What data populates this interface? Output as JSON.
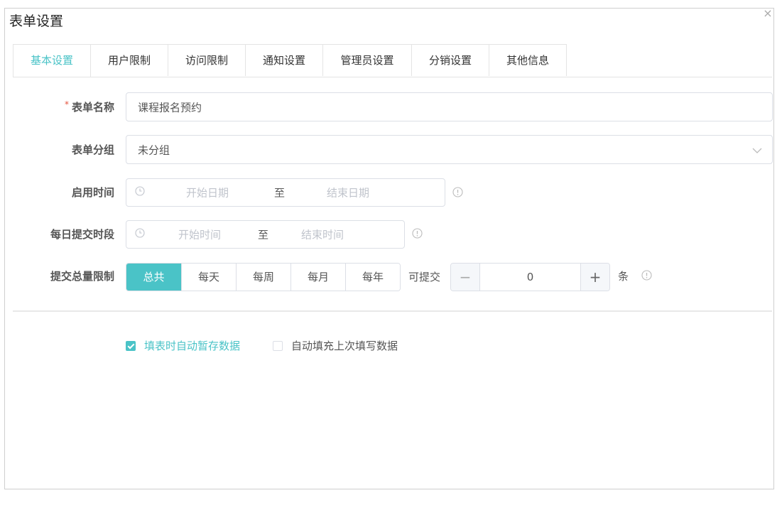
{
  "dialog": {
    "title": "表单设置",
    "close": "×"
  },
  "tabs": [
    {
      "label": "基本设置",
      "active": true
    },
    {
      "label": "用户限制"
    },
    {
      "label": "访问限制"
    },
    {
      "label": "通知设置"
    },
    {
      "label": "管理员设置"
    },
    {
      "label": "分销设置"
    },
    {
      "label": "其他信息"
    }
  ],
  "form": {
    "name": {
      "required_mark": "*",
      "label": "表单名称",
      "value": "课程报名预约"
    },
    "group": {
      "label": "表单分组",
      "value": "未分组"
    },
    "enable_time": {
      "label": "启用时间",
      "start_placeholder": "开始日期",
      "separator": "至",
      "end_placeholder": "结束日期"
    },
    "daily_period": {
      "label": "每日提交时段",
      "start_placeholder": "开始时间",
      "separator": "至",
      "end_placeholder": "结束时间"
    },
    "limit": {
      "label": "提交总量限制",
      "options": [
        "总共",
        "每天",
        "每周",
        "每月",
        "每年"
      ],
      "selected": "总共",
      "prefix": "可提交",
      "value": "0",
      "unit": "条"
    }
  },
  "checkboxes": [
    {
      "label": "填表时自动暂存数据",
      "checked": true
    },
    {
      "label": "自动填充上次填写数据",
      "checked": false
    }
  ],
  "colors": {
    "accent": "#4ac3c7",
    "required": "#e5533d",
    "placeholder": "#c0c4cc"
  },
  "icons": {
    "clock": "clock-icon",
    "info": "info-icon",
    "chevron": "chevron-down-icon"
  }
}
